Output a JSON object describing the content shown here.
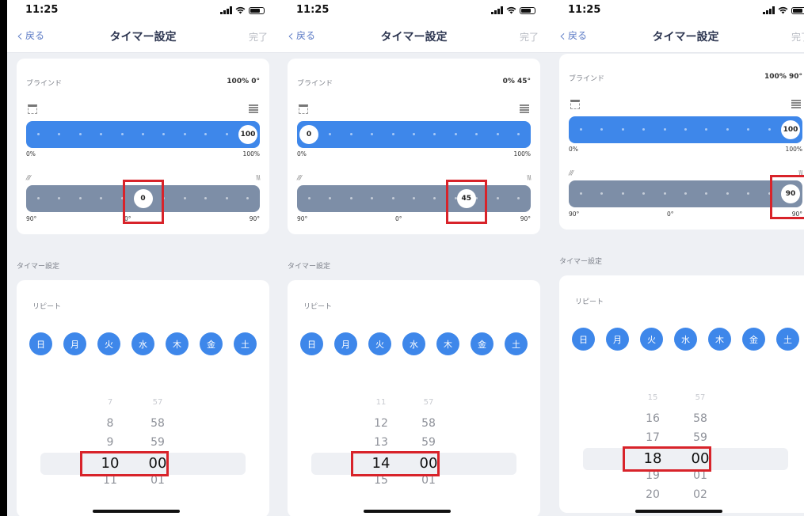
{
  "status_bar": {
    "time": "11:25"
  },
  "nav": {
    "back": "戻る",
    "title": "タイマー設定",
    "done": "完了"
  },
  "screens": [
    {
      "blind_label": "ブラインド",
      "blind_value": "100% 0°",
      "position": {
        "knob": "100",
        "fraction": 1.0,
        "min_label": "0%",
        "max_label": "100%"
      },
      "tilt": {
        "knob": "0",
        "fraction": 0.5,
        "left_label": "90°",
        "mid_label": "0°",
        "right_label": "90°",
        "left_icon": "///",
        "right_icon": "\\\\\\"
      },
      "timer_section": "タイマー設定",
      "repeat_label": "リピート",
      "days": [
        "日",
        "月",
        "火",
        "水",
        "木",
        "金",
        "土"
      ],
      "hours": [
        "7",
        "8",
        "9",
        "10",
        "11"
      ],
      "minutes": [
        "57",
        "58",
        "59",
        "00",
        "01"
      ],
      "highlight": "tilt-knob"
    },
    {
      "blind_label": "ブラインド",
      "blind_value": "0% 45°",
      "position": {
        "knob": "0",
        "fraction": 0.0,
        "min_label": "0%",
        "max_label": "100%"
      },
      "tilt": {
        "knob": "45",
        "fraction": 0.75,
        "left_label": "90°",
        "mid_label": "0°",
        "right_label": "90°",
        "left_icon": "///",
        "right_icon": "\\\\\\"
      },
      "timer_section": "タイマー設定",
      "repeat_label": "リピート",
      "days": [
        "日",
        "月",
        "火",
        "水",
        "木",
        "金",
        "土"
      ],
      "hours": [
        "11",
        "12",
        "13",
        "14",
        "15"
      ],
      "minutes": [
        "57",
        "58",
        "59",
        "00",
        "01"
      ],
      "highlight": "tilt-knob"
    },
    {
      "blind_label": "ブラインド",
      "blind_value": "100% 90°",
      "position": {
        "knob": "100",
        "fraction": 1.0,
        "min_label": "0%",
        "max_label": "100%"
      },
      "tilt": {
        "knob": "90",
        "fraction": 1.0,
        "left_label": "90°",
        "mid_label": "0°",
        "right_label": "90°",
        "left_icon": "///",
        "right_icon": "\\\\\\"
      },
      "timer_section": "タイマー設定",
      "repeat_label": "リピート",
      "days": [
        "日",
        "月",
        "火",
        "水",
        "木",
        "金",
        "土"
      ],
      "hours": [
        "15",
        "16",
        "17",
        "18",
        "19",
        "20"
      ],
      "minutes": [
        "57",
        "58",
        "59",
        "00",
        "01",
        "02"
      ],
      "highlight": "tilt-knob"
    }
  ],
  "colors": {
    "accent": "#3e87ea",
    "tilt_track": "#7d8ea7",
    "highlight_box": "#d8232a"
  }
}
